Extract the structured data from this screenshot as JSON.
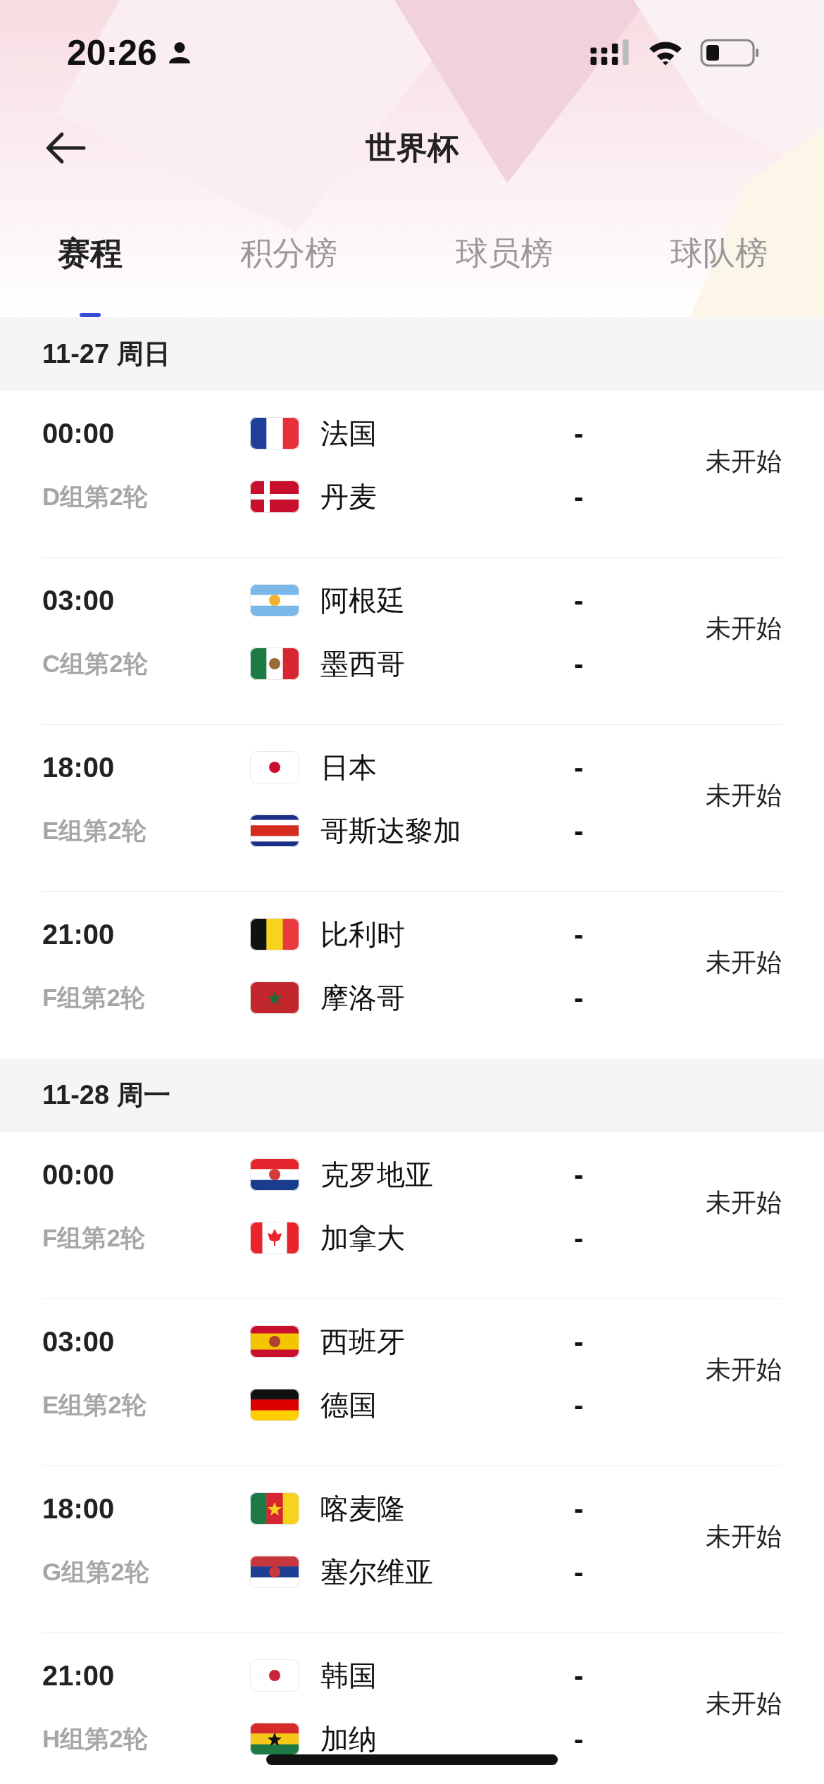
{
  "status_bar": {
    "time": "20:26"
  },
  "header": {
    "title": "世界杯"
  },
  "tabs": [
    {
      "label": "赛程",
      "selected": true
    },
    {
      "label": "积分榜",
      "selected": false
    },
    {
      "label": "球员榜",
      "selected": false
    },
    {
      "label": "球队榜",
      "selected": false
    }
  ],
  "days": [
    {
      "date": "11-27 周日",
      "matches": [
        {
          "time": "00:00",
          "group": "D组第2轮",
          "status": "未开始",
          "teams": [
            {
              "name": "法国",
              "score": "-"
            },
            {
              "name": "丹麦",
              "score": "-"
            }
          ]
        },
        {
          "time": "03:00",
          "group": "C组第2轮",
          "status": "未开始",
          "teams": [
            {
              "name": "阿根廷",
              "score": "-"
            },
            {
              "name": "墨西哥",
              "score": "-"
            }
          ]
        },
        {
          "time": "18:00",
          "group": "E组第2轮",
          "status": "未开始",
          "teams": [
            {
              "name": "日本",
              "score": "-"
            },
            {
              "name": "哥斯达黎加",
              "score": "-"
            }
          ]
        },
        {
          "time": "21:00",
          "group": "F组第2轮",
          "status": "未开始",
          "teams": [
            {
              "name": "比利时",
              "score": "-"
            },
            {
              "name": "摩洛哥",
              "score": "-"
            }
          ]
        }
      ]
    },
    {
      "date": "11-28 周一",
      "matches": [
        {
          "time": "00:00",
          "group": "F组第2轮",
          "status": "未开始",
          "teams": [
            {
              "name": "克罗地亚",
              "score": "-"
            },
            {
              "name": "加拿大",
              "score": "-"
            }
          ]
        },
        {
          "time": "03:00",
          "group": "E组第2轮",
          "status": "未开始",
          "teams": [
            {
              "name": "西班牙",
              "score": "-"
            },
            {
              "name": "德国",
              "score": "-"
            }
          ]
        },
        {
          "time": "18:00",
          "group": "G组第2轮",
          "status": "未开始",
          "teams": [
            {
              "name": "喀麦隆",
              "score": "-"
            },
            {
              "name": "塞尔维亚",
              "score": "-"
            }
          ]
        },
        {
          "time": "21:00",
          "group": "H组第2轮",
          "status": "未开始",
          "teams": [
            {
              "name": "韩国",
              "score": "-"
            },
            {
              "name": "加纳",
              "score": "-"
            }
          ]
        }
      ]
    }
  ]
}
